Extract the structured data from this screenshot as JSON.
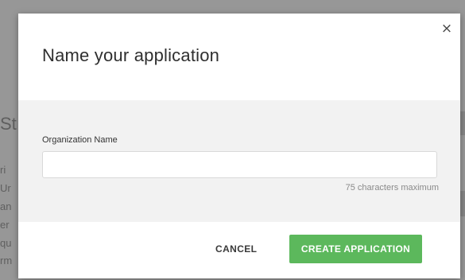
{
  "backdrop": {
    "heading_fragment": "St",
    "lines": [
      "ri",
      "Ur",
      "an",
      "er",
      "qu",
      "rm"
    ]
  },
  "dialog": {
    "title": "Name your application",
    "close_glyph": "×",
    "field": {
      "label": "Organization Name",
      "value": "",
      "placeholder": "",
      "hint": "75 characters maximum"
    },
    "buttons": {
      "cancel_label": "CANCEL",
      "create_label": "CREATE APPLICATION"
    }
  },
  "colors": {
    "primary_button": "#5cb85c",
    "body_band": "#f2f2f2",
    "overlay": "#979797"
  },
  "icons": {
    "close": "close-icon"
  }
}
